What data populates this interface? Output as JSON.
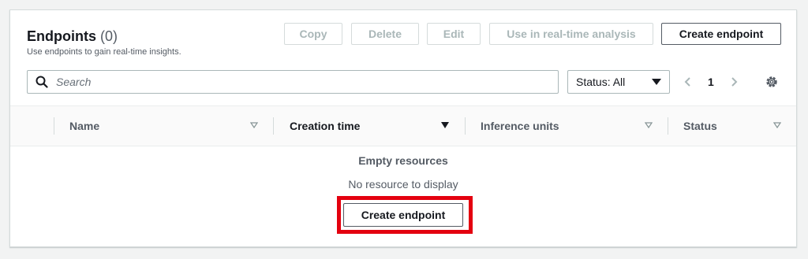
{
  "header": {
    "title": "Endpoints",
    "count": "(0)",
    "description": "Use endpoints to gain real-time insights."
  },
  "actions": {
    "copy": "Copy",
    "delete": "Delete",
    "edit": "Edit",
    "realtime": "Use in real-time analysis",
    "create": "Create endpoint"
  },
  "filter": {
    "search_placeholder": "Search",
    "status_select": "Status: All"
  },
  "pagination": {
    "current_page": "1"
  },
  "table": {
    "columns": [
      "Name",
      "Creation time",
      "Inference units",
      "Status"
    ],
    "sorted_column": "Creation time"
  },
  "empty_state": {
    "title": "Empty resources",
    "message": "No resource to display",
    "button": "Create endpoint"
  },
  "colors": {
    "highlight": "#e4000f",
    "disabled_text": "#aab7b8",
    "primary_text": "#16191f"
  }
}
